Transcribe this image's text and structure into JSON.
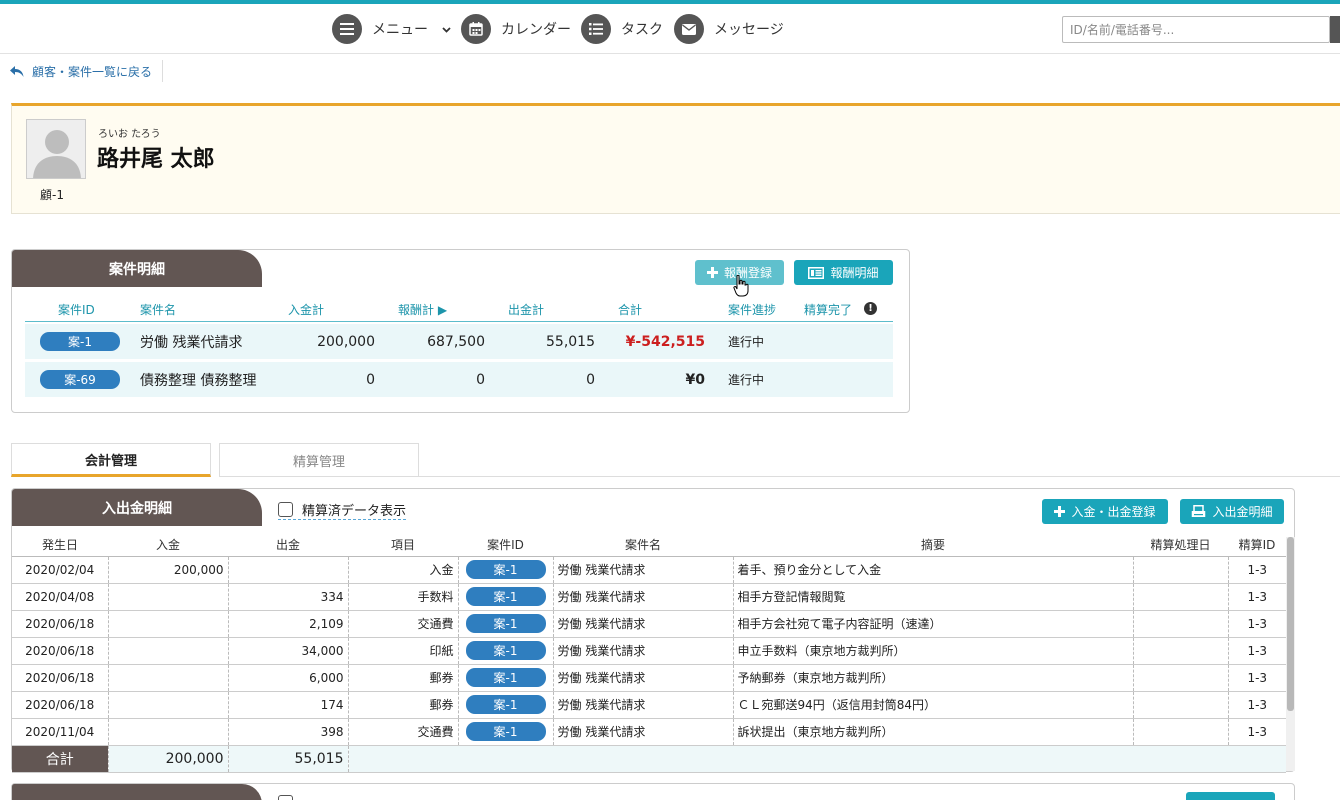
{
  "nav": {
    "menu": "メニュー",
    "calendar": "カレンダー",
    "task": "タスク",
    "message": "メッセージ",
    "search_placeholder": "ID/名前/電話番号..."
  },
  "back_link": "顧客・案件一覧に戻る",
  "client": {
    "kana": "ろいお たろう",
    "name": "路井尾 太郎",
    "id": "顧-1"
  },
  "cases": {
    "title": "案件明細",
    "btn_register": "報酬登録",
    "btn_detail": "報酬明細",
    "headers": [
      "案件ID",
      "案件名",
      "入金計",
      "報酬計 ▶",
      "出金計",
      "合計",
      "案件進捗",
      "精算完了"
    ],
    "rows": [
      {
        "id": "案-1",
        "name": "労働 残業代請求",
        "in": "200,000",
        "fee": "687,500",
        "out": "55,015",
        "total": "¥-542,515",
        "status": "進行中"
      },
      {
        "id": "案-69",
        "name": "債務整理 債務整理",
        "in": "0",
        "fee": "0",
        "out": "0",
        "total": "¥0",
        "status": "進行中"
      }
    ],
    "colors": {
      "negative_total": "#cc1f1f"
    }
  },
  "tabs": {
    "accounting": "会計管理",
    "settlement": "精算管理"
  },
  "ledger": {
    "title": "入出金明細",
    "checkbox_label": "精算済データ表示",
    "btn_register": "入金・出金登録",
    "btn_detail": "入出金明細",
    "headers": [
      "発生日",
      "入金",
      "出金",
      "項目",
      "案件ID",
      "案件名",
      "摘要",
      "精算処理日",
      "精算ID"
    ],
    "rows": [
      {
        "date": "2020/02/04",
        "in": "200,000",
        "out": "",
        "item": "入金",
        "case": "案-1",
        "name": "労働 残業代請求",
        "memo": "着手、預り金分として入金",
        "sdate": "",
        "sid": "1-3"
      },
      {
        "date": "2020/04/08",
        "in": "",
        "out": "334",
        "item": "手数料",
        "case": "案-1",
        "name": "労働 残業代請求",
        "memo": "相手方登記情報閲覧",
        "sdate": "",
        "sid": "1-3"
      },
      {
        "date": "2020/06/18",
        "in": "",
        "out": "2,109",
        "item": "交通費",
        "case": "案-1",
        "name": "労働 残業代請求",
        "memo": "相手方会社宛て電子内容証明（速達）",
        "sdate": "",
        "sid": "1-3"
      },
      {
        "date": "2020/06/18",
        "in": "",
        "out": "34,000",
        "item": "印紙",
        "case": "案-1",
        "name": "労働 残業代請求",
        "memo": "申立手数料（東京地方裁判所）",
        "sdate": "",
        "sid": "1-3"
      },
      {
        "date": "2020/06/18",
        "in": "",
        "out": "6,000",
        "item": "郵券",
        "case": "案-1",
        "name": "労働 残業代請求",
        "memo": "予納郵券（東京地方裁判所）",
        "sdate": "",
        "sid": "1-3"
      },
      {
        "date": "2020/06/18",
        "in": "",
        "out": "174",
        "item": "郵券",
        "case": "案-1",
        "name": "労働 残業代請求",
        "memo": "ＣＬ宛郵送94円（返信用封筒84円）",
        "sdate": "",
        "sid": "1-3"
      },
      {
        "date": "2020/11/04",
        "in": "",
        "out": "398",
        "item": "交通費",
        "case": "案-1",
        "name": "労働 残業代請求",
        "memo": "訴状提出（東京地方裁判所）",
        "sdate": "",
        "sid": "1-3"
      }
    ],
    "total_label": "合計",
    "total_in": "200,000",
    "total_out": "55,015"
  },
  "theme": {
    "accent": "#1aa5ba",
    "header_dark": "#625653",
    "pill_blue": "#2f7ebf",
    "gold": "#e8a52b"
  }
}
